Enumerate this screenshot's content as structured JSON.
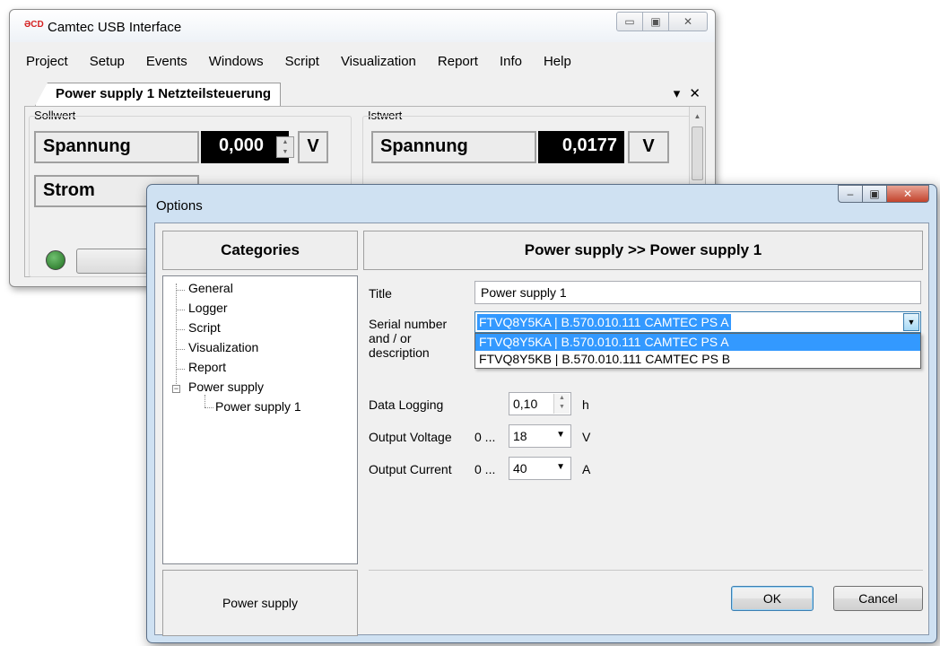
{
  "main_window": {
    "title": "Camtec USB Interface",
    "logo_text": "ƏCD",
    "menu": [
      "Project",
      "Setup",
      "Events",
      "Windows",
      "Script",
      "Visualization",
      "Report",
      "Info",
      "Help"
    ],
    "tab_label": "Power supply 1 Netzteilsteuerung",
    "tab_dropdown_icon": "▾",
    "tab_close_icon": "✕",
    "sollwert": {
      "group_label": "Sollwert",
      "spannung_label": "Spannung",
      "spannung_value": "0,000",
      "spannung_unit": "V",
      "strom_label": "Strom"
    },
    "istwert": {
      "group_label": "Istwert",
      "spannung_label": "Spannung",
      "spannung_value": "0,0177",
      "spannung_unit": "V"
    },
    "window_controls": {
      "minimize": "▭",
      "maximize": "▣",
      "close": "✕"
    }
  },
  "options_dialog": {
    "title": "Options",
    "window_controls": {
      "minimize": "–",
      "maximize": "▣",
      "close": "✕"
    },
    "categories_header": "Categories",
    "panel_header": "Power supply >> Power supply 1",
    "tree": [
      {
        "label": "General"
      },
      {
        "label": "Logger"
      },
      {
        "label": "Script"
      },
      {
        "label": "Visualization"
      },
      {
        "label": "Report"
      },
      {
        "label": "Power supply",
        "expander": "−"
      },
      {
        "label": "Power supply 1"
      }
    ],
    "footer_label": "Power supply",
    "title_label": "Title",
    "title_value": "Power supply 1",
    "serial_label": "Serial number and / or description",
    "serial_selected": "FTVQ8Y5KA | B.570.010.111 CAMTEC PS A",
    "serial_options": [
      "FTVQ8Y5KA | B.570.010.111 CAMTEC PS A",
      "FTVQ8Y5KB | B.570.010.111 CAMTEC PS B"
    ],
    "data_logging_label": "Data Logging",
    "data_logging_value": "0,10",
    "data_logging_unit": "h",
    "output_voltage_label": "Output Voltage",
    "output_voltage_prefix": "0 ...",
    "output_voltage_value": "18",
    "output_voltage_unit": "V",
    "output_current_label": "Output Current",
    "output_current_prefix": "0 ...",
    "output_current_value": "40",
    "output_current_unit": "A",
    "ok_label": "OK",
    "cancel_label": "Cancel"
  }
}
